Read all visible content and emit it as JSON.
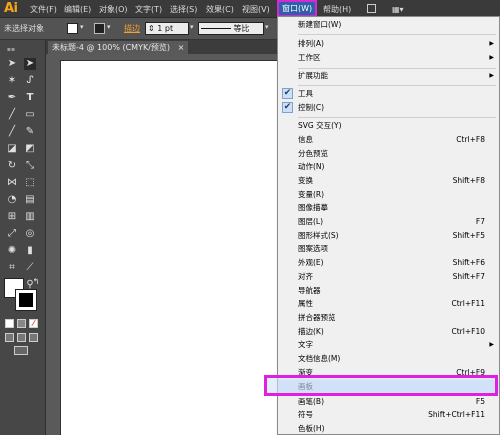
{
  "app": {
    "logo": "Ai"
  },
  "menubar": {
    "items": [
      "文件(F)",
      "编辑(E)",
      "对象(O)",
      "文字(T)",
      "选择(S)",
      "效果(C)",
      "视图(V)",
      "窗口(W)",
      "帮助(H)"
    ]
  },
  "control_bar": {
    "selection": "未选择对象",
    "stroke_label": "描边",
    "stroke_weight": "1 pt",
    "profile": "等比"
  },
  "document": {
    "tab": "未标题-4 @ 100% (CMYK/预览)",
    "close": "×"
  },
  "window_menu": {
    "new_window": "新建窗口(W)",
    "arrange": "排列(A)",
    "workspace": "工作区",
    "extensions": "扩展功能",
    "tools": "工具",
    "control": "控制(C)",
    "svg": "SVG 交互(Y)",
    "info": "信息",
    "info_sc": "Ctrl+F8",
    "separation": "分色预览",
    "actions": "动作(N)",
    "transform": "变换",
    "transform_sc": "Shift+F8",
    "variables": "变量(R)",
    "trace": "图像描摹",
    "layers": "图层(L)",
    "layers_sc": "F7",
    "graphic_styles": "图形样式(S)",
    "graphic_styles_sc": "Shift+F5",
    "pattern": "图案选项",
    "appearance": "外观(E)",
    "appearance_sc": "Shift+F6",
    "align": "对齐",
    "align_sc": "Shift+F7",
    "navigator": "导航器",
    "attributes": "属性",
    "attributes_sc": "Ctrl+F11",
    "flattener": "拼合器预览",
    "stroke": "描边(K)",
    "stroke_sc": "Ctrl+F10",
    "type": "文字",
    "doc_info": "文档信息(M)",
    "gradient": "渐变",
    "gradient_sc": "Ctrl+F9",
    "artboards": "画板",
    "brushes": "画笔(B)",
    "brushes_sc": "F5",
    "symbols": "符号",
    "symbols_sc": "Shift+Ctrl+F11",
    "swatches": "色板(H)"
  },
  "colors": {
    "highlight": "#e020e0",
    "menu_bg": "#f0f0f0",
    "brand": "#f7a51d"
  }
}
